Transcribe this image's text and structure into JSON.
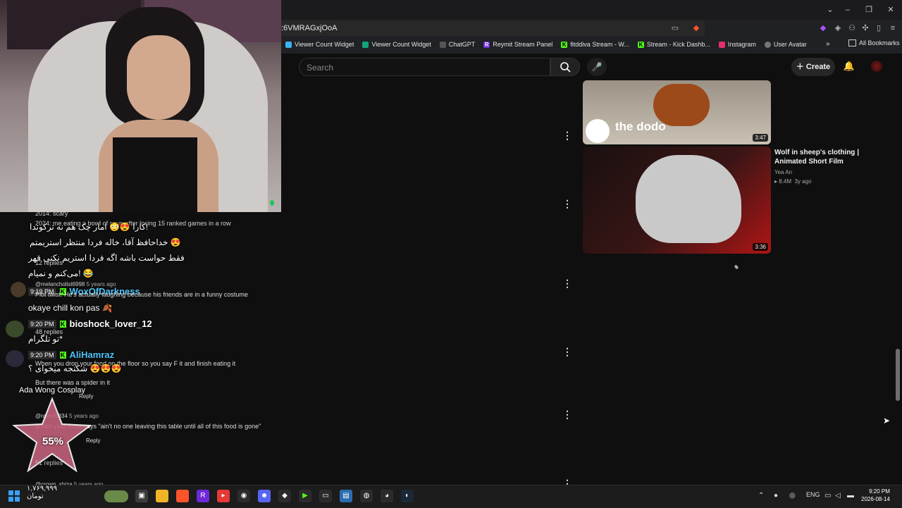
{
  "browser": {
    "url_fragment": ":6VMRAGxjOoA",
    "bookmarks": [
      "Viewer Count Widget",
      "Viewer Count Widget",
      "ChatGPT",
      "Reymit Stream Panel",
      "fitddiva Stream - W...",
      "Stream - Kick Dashb...",
      "Instagram",
      "User Avatar"
    ],
    "all_bookmarks": "All Bookmarks",
    "more": "»"
  },
  "youtube": {
    "search_placeholder": "Search",
    "create_label": "Create",
    "videos": [
      {
        "duration": "3:47",
        "channel_logo": "the dodo"
      },
      {
        "title": "Wolf in sheep's clothing | Animated Short Film",
        "channel": "Yea An",
        "views": "8.4M",
        "age": "3y ago",
        "duration": "3:36"
      }
    ]
  },
  "chat": {
    "lines": [
      {
        "text": "2014: scary"
      },
      {
        "text": "2024: me eating a bowl of soup after losing 15 ranked games in a row"
      },
      {
        "text": "کارا 😍😳 امار چک هم نه ترکوندا!"
      },
      {
        "text": "خداحافظ آقا، خاله فردا منتظر استریمتم 😍"
      },
      {
        "text": "فقط حواست باشه اگه فردا استریم نکنی قهر"
      },
      {
        "text": "می‌کنم و نمیام! 😂"
      },
      {
        "text": "12 replies"
      },
      {
        "text": "@melancholist6998",
        "meta": "5 years ago"
      },
      {
        "text": "9:19 PM",
        "user": "WoxOfDarkness"
      },
      {
        "text": "Plot twist: He's actually laughing because his friends are in a funny costume"
      },
      {
        "text": "okaye chill kon pas 🍂"
      },
      {
        "text": "9:20 PM",
        "user": "bioshock_lover_12"
      },
      {
        "text": "48 replies"
      },
      {
        "text": "تو تلگرام*"
      },
      {
        "text": "9:20 PM",
        "user": "AliHamraz"
      },
      {
        "text": "When you drop your food on the floor so you say F it and finish eating it"
      },
      {
        "text": "شکنجه میخوای ؟ 😍😍😍"
      },
      {
        "text": "But there was a spider in it"
      },
      {
        "text": "Ada Wong Cosplay"
      },
      {
        "text": "Reply"
      },
      {
        "text": "@raven5834",
        "meta": "5 years ago"
      },
      {
        "text": "When your mom says \"ain't no one leaving this table until all of this food is gone\""
      },
      {
        "text": "Reply"
      },
      {
        "text": "51 replies"
      },
      {
        "text": "55%"
      },
      {
        "text": "@crown_shiza",
        "meta": "5 years ago"
      }
    ],
    "balance": "۱,۷۶۹,۹۹۹",
    "balance_label": "تومان"
  },
  "taskbar": {
    "time": "9:20 PM",
    "date": "2026-08-14",
    "lang": "ENG"
  },
  "colors": {
    "kick_green": "#53fc18",
    "bg": "#0f0f0f"
  }
}
